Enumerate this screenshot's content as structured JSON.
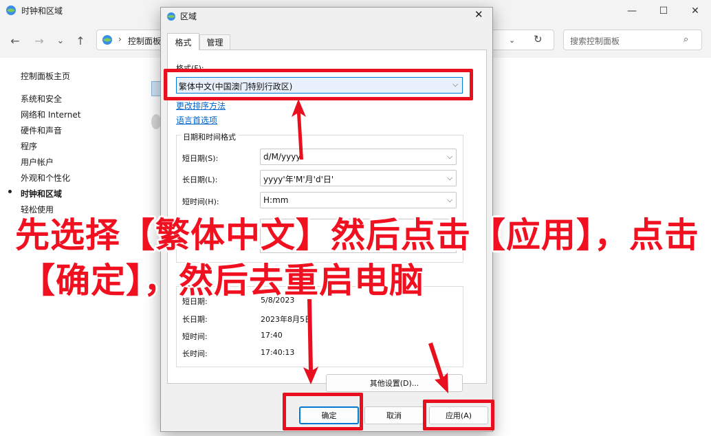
{
  "window": {
    "title": "时钟和区域",
    "controls": {
      "minimize": "—",
      "maximize": "☐",
      "close": "✕"
    }
  },
  "nav": {
    "back": "←",
    "forward": "→",
    "dropdown": "⌄",
    "up": "↑",
    "address_chevron": "›",
    "address": "控制面板",
    "refresh": "↻",
    "address_dropdown": "⌄",
    "search_placeholder": "搜索控制面板",
    "search_icon": "⌕"
  },
  "sidebar": {
    "items": [
      {
        "label": "控制面板主页"
      },
      {
        "label": "系统和安全"
      },
      {
        "label": "网络和 Internet"
      },
      {
        "label": "硬件和声音"
      },
      {
        "label": "程序"
      },
      {
        "label": "用户帐户"
      },
      {
        "label": "外观和个性化"
      },
      {
        "label": "时钟和区域",
        "active": true
      },
      {
        "label": "轻松使用"
      }
    ]
  },
  "dialog": {
    "title": "区域",
    "close": "✕",
    "tabs": [
      {
        "label": "格式",
        "active": true
      },
      {
        "label": "管理"
      }
    ],
    "format_label": "格式(F):",
    "format_value": "繁体中文(中国澳门特别行政区)",
    "links": {
      "sort": "更改排序方法",
      "language": "语言首选项"
    },
    "datetime_group": {
      "title": "日期和时间格式",
      "rows": [
        {
          "label": "短日期(S):",
          "value": "d/M/yyyy"
        },
        {
          "label": "长日期(L):",
          "value": "yyyy'年'M'月'd'日'"
        },
        {
          "label": "短时间(H):",
          "value": "H:mm"
        }
      ]
    },
    "example_group": {
      "title": "示例",
      "rows": [
        {
          "label": "短日期:",
          "value": "5/8/2023"
        },
        {
          "label": "长日期:",
          "value": "2023年8月5日"
        },
        {
          "label": "短时间:",
          "value": "17:40"
        },
        {
          "label": "长时间:",
          "value": "17:40:13"
        }
      ]
    },
    "buttons": {
      "other": "其他设置(D)...",
      "ok": "确定",
      "cancel": "取消",
      "apply": "应用(A)"
    },
    "chevron": "⌵"
  },
  "annotation": {
    "line1": "先选择【繁体中文】然后点击【应用】，点击",
    "line2": "【确定】，然后去重启电脑",
    "color": "#e8101e"
  }
}
